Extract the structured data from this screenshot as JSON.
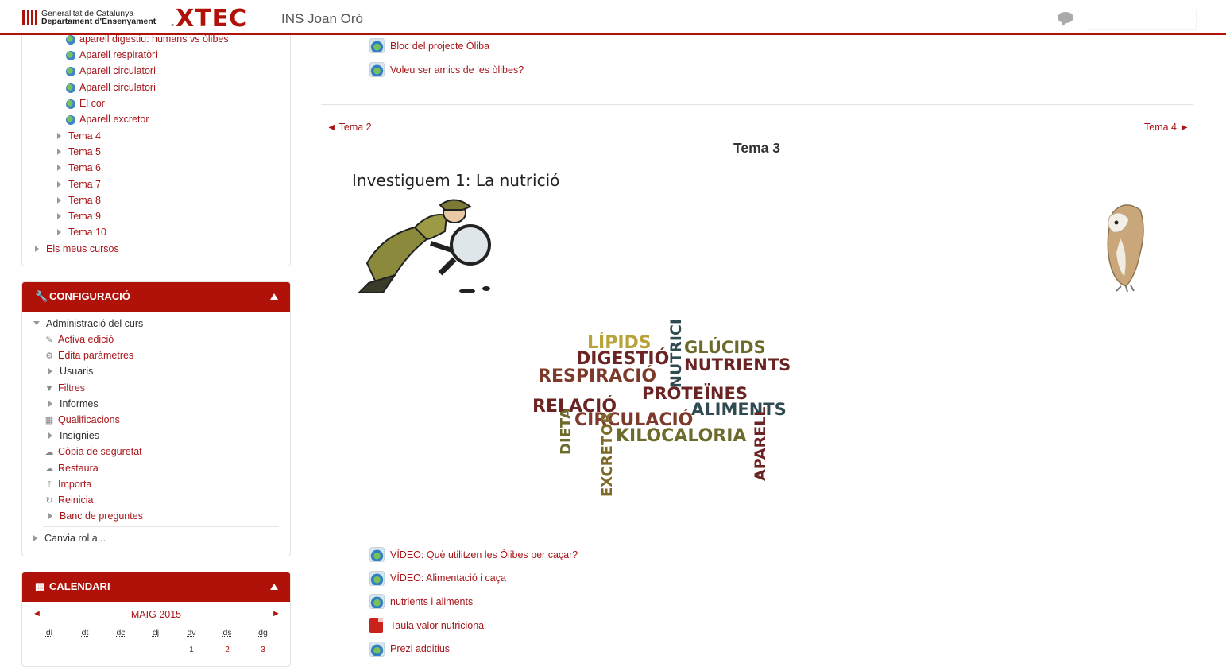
{
  "header": {
    "gencat_line1": "Generalitat de Catalunya",
    "gencat_line2": "Departament d'Ensenyament",
    "logo": "XTEC",
    "school": "INS Joan Oró"
  },
  "nav": {
    "resources": [
      "aparell digestiu: humans vs òlibes",
      "Aparell respiratòri",
      "Aparell circulatori",
      "Aparell circulatori",
      "El cor",
      "Aparell excretor"
    ],
    "topics": [
      "Tema 4",
      "Tema 5",
      "Tema 6",
      "Tema 7",
      "Tema 8",
      "Tema 9",
      "Tema 10"
    ],
    "my_courses": "Els meus cursos"
  },
  "config": {
    "title": "CONFIGURACIÓ",
    "admin": "Administració del curs",
    "items": [
      "Activa edició",
      "Edita paràmetres",
      "Usuaris",
      "Filtres",
      "Informes",
      "Qualificacions",
      "Insígnies",
      "Còpia de seguretat",
      "Restaura",
      "Importa",
      "Reinicia",
      "Banc de preguntes"
    ],
    "switch_role": "Canvia rol a..."
  },
  "calendar": {
    "title": "CALENDARI",
    "month": "MAIG 2015",
    "prev": "◄",
    "next": "►",
    "days_of_week": [
      "dl",
      "dt",
      "dc",
      "dj",
      "dv",
      "ds",
      "dg"
    ],
    "first_row": [
      "1",
      "2",
      "3"
    ]
  },
  "main": {
    "top_links": [
      "Bloc del projecte Òliba",
      "Voleu ser amics de les òlibes?"
    ],
    "prev_section": "◄ Tema 2",
    "next_section": "Tema 4 ►",
    "section_title": "Tema 3",
    "heading": "Investiguem 1: La nutrició",
    "wordcloud_words": [
      "LÍPIDS",
      "DIGESTIÓ",
      "GLÚCIDS",
      "NUTRIENTS",
      "RESPIRACIÓ",
      "NUTRICIÓ",
      "PROTEÏNES",
      "RELACIÓ",
      "ALIMENTS",
      "CIRCULACIÓ",
      "DIETA",
      "KILOCALORIA",
      "EXCRETOR",
      "APARELL"
    ],
    "activities": [
      "VÍDEO: Què utilitzen les Òlibes per caçar?",
      "VÍDEO: Alimentació i caça",
      "nutrients i aliments",
      "Taula valor nutricional",
      "Prezi additius"
    ]
  }
}
